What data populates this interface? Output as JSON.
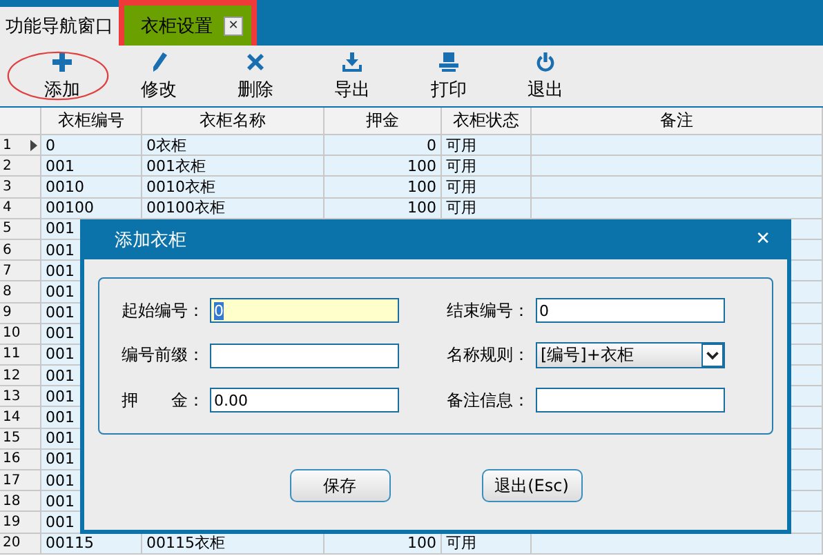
{
  "tabs": [
    {
      "label": "功能导航窗口",
      "selected": false,
      "closable": false
    },
    {
      "label": "衣柜设置",
      "selected": true,
      "closable": true,
      "close": "✕"
    }
  ],
  "toolbar": [
    {
      "kind": "add",
      "label": "添加",
      "highlighted": true
    },
    {
      "kind": "edit",
      "label": "修改",
      "highlighted": false
    },
    {
      "kind": "delete",
      "label": "删除",
      "highlighted": false
    },
    {
      "kind": "export",
      "label": "导出",
      "highlighted": false
    },
    {
      "kind": "print",
      "label": "打印",
      "highlighted": false
    },
    {
      "kind": "exit",
      "label": "退出",
      "highlighted": false
    }
  ],
  "table": {
    "columns": [
      "衣柜编号",
      "衣柜名称",
      "押金",
      "衣柜状态",
      "备注"
    ],
    "rows": [
      {
        "num": "1",
        "code": "0",
        "name": "0衣柜",
        "deposit": "0",
        "status": "可用",
        "selected": true
      },
      {
        "num": "2",
        "code": "001",
        "name": "001衣柜",
        "deposit": "100",
        "status": "可用",
        "selected": false
      },
      {
        "num": "3",
        "code": "0010",
        "name": "0010衣柜",
        "deposit": "100",
        "status": "可用",
        "selected": false
      },
      {
        "num": "4",
        "code": "00100",
        "name": "00100衣柜",
        "deposit": "100",
        "status": "可用",
        "selected": false
      },
      {
        "num": "5",
        "code": "001",
        "selected": false
      },
      {
        "num": "6",
        "code": "001",
        "selected": false
      },
      {
        "num": "7",
        "code": "001",
        "selected": false
      },
      {
        "num": "8",
        "code": "001",
        "selected": false
      },
      {
        "num": "9",
        "code": "001",
        "selected": false
      },
      {
        "num": "10",
        "code": "001",
        "selected": false
      },
      {
        "num": "11",
        "code": "001",
        "selected": false
      },
      {
        "num": "12",
        "code": "001",
        "selected": false
      },
      {
        "num": "13",
        "code": "001",
        "selected": false
      },
      {
        "num": "14",
        "code": "001",
        "selected": false
      },
      {
        "num": "15",
        "code": "001",
        "selected": false
      },
      {
        "num": "16",
        "code": "001",
        "selected": false
      },
      {
        "num": "17",
        "code": "001",
        "selected": false
      },
      {
        "num": "18",
        "code": "001",
        "selected": false
      },
      {
        "num": "19",
        "code": "001",
        "selected": false
      },
      {
        "num": "20",
        "code": "00115",
        "name": "00115衣柜",
        "deposit": "100",
        "status": "可用",
        "selected": false
      }
    ]
  },
  "dialog": {
    "title": "添加衣柜",
    "close": "✕",
    "fields": [
      {
        "kind": "text",
        "label": "起始编号：",
        "value": "0",
        "focused": true
      },
      {
        "kind": "text",
        "label": "结束编号：",
        "value": "0",
        "focused": false
      },
      {
        "kind": "text",
        "label": "编号前缀：",
        "focused": false
      },
      {
        "kind": "select",
        "label": "名称规则：",
        "value": "[编号]+衣柜"
      },
      {
        "kind": "text",
        "label": "押　　金：",
        "value": "0.00",
        "focused": false
      },
      {
        "kind": "text",
        "label": "备注信息：",
        "focused": false
      }
    ],
    "buttons": [
      "保存",
      "退出(Esc)"
    ]
  }
}
